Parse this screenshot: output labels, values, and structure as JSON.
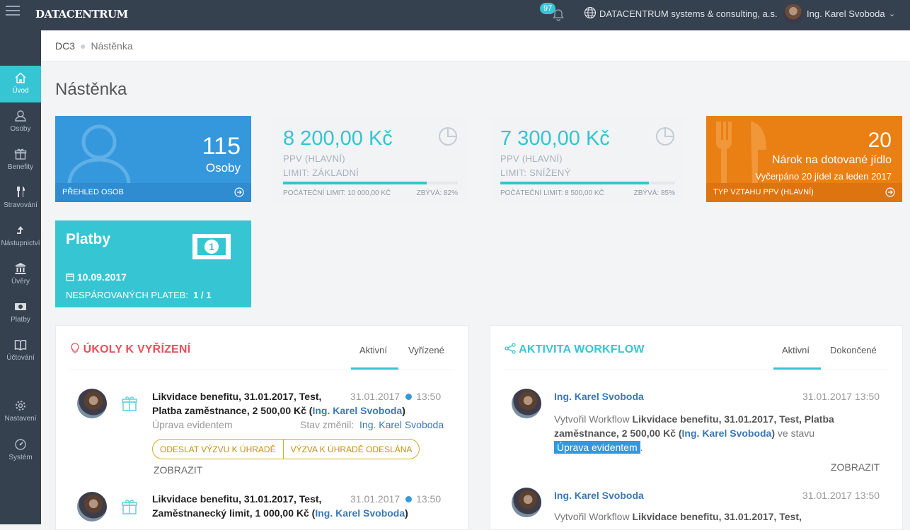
{
  "topbar": {
    "logo": "DATACENTRUM",
    "notif_count": "97",
    "company": "DATACENTRUM systems & consulting, a.s.",
    "user": "Ing. Karel Svoboda"
  },
  "sidebar": {
    "items": [
      {
        "label": "Úvod",
        "icon": "home-icon"
      },
      {
        "label": "Osoby",
        "icon": "user-icon"
      },
      {
        "label": "Benefity",
        "icon": "gift-icon"
      },
      {
        "label": "Stravování",
        "icon": "cutlery-icon"
      },
      {
        "label": "Nástupnictví",
        "icon": "arrow-up-icon"
      },
      {
        "label": "Úvěry",
        "icon": "bank-icon"
      },
      {
        "label": "Platby",
        "icon": "money-icon"
      },
      {
        "label": "Účtování",
        "icon": "book-icon"
      },
      {
        "label": "Nastavení",
        "icon": "gear-icon"
      },
      {
        "label": "Systém",
        "icon": "dashboard-icon"
      }
    ]
  },
  "breadcrumb": {
    "root": "DC3",
    "current": "Nástěnka"
  },
  "page_title": "Nástěnka",
  "tiles": {
    "persons": {
      "count": "115",
      "label": "Osoby",
      "footer": "PŘEHLED OSOB"
    },
    "ppv_basic": {
      "amount": "8 200,00 Kč",
      "line1": "PPV (HLAVNÍ)",
      "line2": "LIMIT: ZÁKLADNÍ",
      "progress": 0.82,
      "footer_left": "POČÁTEČNÍ LIMIT: 10 000,00 KČ",
      "footer_right": "ZBÝVÁ: 82%"
    },
    "ppv_reduced": {
      "amount": "7 300,00 Kč",
      "line1": "PPV (HLAVNÍ)",
      "line2": "LIMIT: SNÍŽENÝ",
      "progress": 0.85,
      "footer_left": "POČÁTEČNÍ LIMIT: 8 500,00 KČ",
      "footer_right": "ZBÝVÁ: 85%"
    },
    "meals": {
      "count": "20",
      "line1": "Nárok na dotované jídlo",
      "line2": "Vyčerpáno 20 jídel za leden 2017",
      "footer": "TYP VZTAHU PPV (HLAVNÍ)"
    },
    "payments": {
      "title": "Platby",
      "date": "10.09.2017",
      "unpaired_label": "NESPÁROVANÝCH PLATEB:",
      "unpaired_value": "1 / 1"
    }
  },
  "tasks": {
    "title": "ÚKOLY K VYŘÍZENÍ",
    "tabs": [
      "Aktivní",
      "Vyřízené"
    ],
    "items": [
      {
        "title1": "Likvidace benefitu, 31.01.2017, Test,",
        "title2_pre": "Platba zaměstnance, 2 500,00 Kč (",
        "person": "Ing. Karel Svoboda",
        "title2_post": ")",
        "date": "31.01.2017",
        "time": "13:50",
        "state": "Úprava evidentem",
        "changed_label": "Stav změnil:",
        "changed_by": "Ing. Karel Svoboda",
        "action1": "ODESLAT VÝZVU K ÚHRADĚ",
        "action2": "VÝZVA K ÚHRADĚ ODESLÁNA",
        "show": "ZOBRAZIT"
      },
      {
        "title1": "Likvidace benefitu, 31.01.2017, Test,",
        "title2_pre": "Zaměstnanecký limit, 1 000,00 Kč (",
        "person": "Ing. Karel Svoboda",
        "title2_post": ")",
        "date": "31.01.2017",
        "time": "13:50"
      }
    ]
  },
  "workflow": {
    "title": "AKTIVITA WORKFLOW",
    "tabs": [
      "Aktivní",
      "Dokončené"
    ],
    "items": [
      {
        "name": "Ing. Karel Svoboda",
        "datetime": "31.01.2017 13:50",
        "text_pre": "Vytvořil Workflow ",
        "bold1": "Likvidace benefitu, 31.01.2017, Test, Platba",
        "bold2": "zaměstnance, 2 500,00 Kč (",
        "person": "Ing. Karel Svoboda",
        "bold3": ")",
        "text_post": " ve stavu",
        "state": "Úprava evidentem",
        "state_post": ".",
        "show": "ZOBRAZIT"
      },
      {
        "name": "Ing. Karel Svoboda",
        "datetime": "31.01.2017 13:50",
        "text_pre": "Vytvořil Workflow ",
        "bold1": "Likvidace benefitu, 31.01.2017, Test,"
      }
    ]
  },
  "colors": {
    "sidebar": "#364150",
    "accent": "#36c6d3",
    "blue": "#3598dc",
    "orange": "#ea7f13",
    "red": "#e7505a"
  }
}
